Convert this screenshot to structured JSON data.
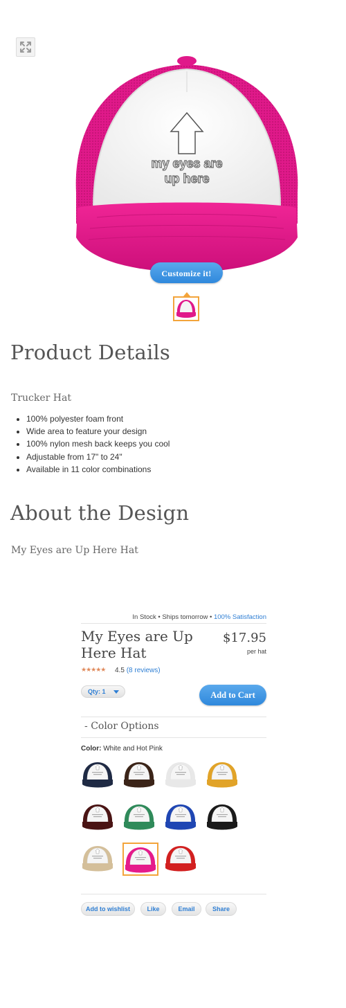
{
  "hero": {
    "hat_text_line1": "my eyes are",
    "hat_text_line2": "up here",
    "customize_label": "Customize it!",
    "hat_color": "#e51b8b",
    "icons": [
      "expand-icon",
      "up-arrow-icon"
    ]
  },
  "product_details": {
    "heading": "Product Details",
    "product_type": "Trucker Hat",
    "bullets": [
      "100% polyester foam front",
      "Wide area to feature your design",
      "100% nylon mesh back keeps you cool",
      "Adjustable from 17\" to 24\"",
      "Available in 11 color combinations"
    ]
  },
  "about": {
    "heading": "About the Design",
    "description": "My Eyes are Up Here Hat"
  },
  "purchase": {
    "in_stock": "In Stock",
    "ships": "Ships tomorrow",
    "satisfaction": "100% Satisfaction",
    "separator": "•",
    "title": "My Eyes are Up Here Hat",
    "price": "$17.95",
    "per_unit": "per hat",
    "rating_value": "4.5",
    "rating_stars": 4.5,
    "reviews": "(8 reviews)",
    "qty_label": "Qty: 1",
    "add_to_cart": "Add to Cart",
    "color_options_toggle": "-",
    "color_options_heading": "Color Options",
    "color_label": "Color:",
    "color_value": "White and Hot Pink",
    "swatches": [
      {
        "name": "navy",
        "color": "#1f2a44"
      },
      {
        "name": "brown",
        "color": "#3b2418"
      },
      {
        "name": "white",
        "color": "#e8e8e8"
      },
      {
        "name": "gold",
        "color": "#e1a328"
      },
      {
        "name": "maroon",
        "color": "#4a1414"
      },
      {
        "name": "green",
        "color": "#2f8a5a"
      },
      {
        "name": "royal",
        "color": "#1f46b3"
      },
      {
        "name": "black",
        "color": "#1a1a1a"
      },
      {
        "name": "khaki",
        "color": "#d4bf9a"
      },
      {
        "name": "hot-pink",
        "color": "#e51b8b",
        "selected": true
      },
      {
        "name": "red",
        "color": "#d22020"
      }
    ],
    "actions": [
      "Add to wishlist",
      "Like",
      "Email",
      "Share"
    ]
  },
  "colors": {
    "accent_blue": "#2f88dc",
    "selection_orange": "#f3a43b",
    "star_color": "#e08a5c"
  }
}
